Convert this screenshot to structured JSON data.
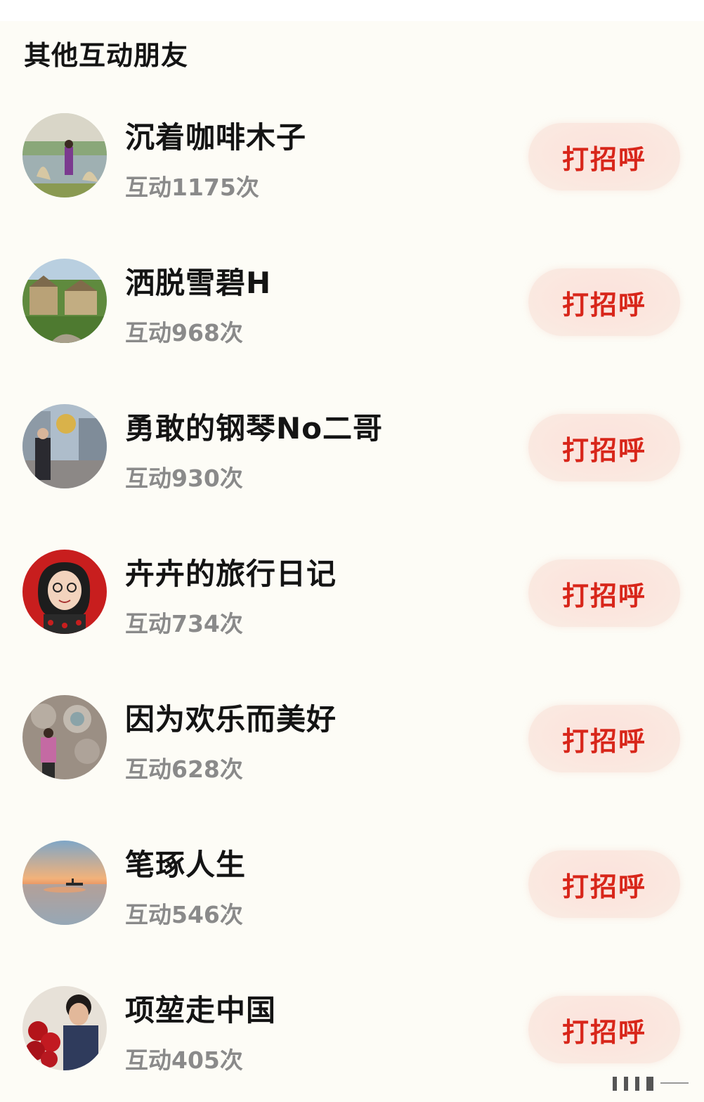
{
  "section": {
    "title": "其他互动朋友"
  },
  "friends": [
    {
      "name": "沉着咖啡木子",
      "count": "互动1175次",
      "button_label": "打招呼",
      "avatar_icon": "avatar-lakeside-photo"
    },
    {
      "name": "洒脱雪碧H",
      "count": "互动968次",
      "button_label": "打招呼",
      "avatar_icon": "avatar-village-photo"
    },
    {
      "name": "勇敢的钢琴No二哥",
      "count": "互动930次",
      "button_label": "打招呼",
      "avatar_icon": "avatar-city-square-photo"
    },
    {
      "name": "卉卉的旅行日记",
      "count": "互动734次",
      "button_label": "打招呼",
      "avatar_icon": "avatar-cartoon-portrait"
    },
    {
      "name": "因为欢乐而美好",
      "count": "互动628次",
      "button_label": "打招呼",
      "avatar_icon": "avatar-sculpture-wall-photo"
    },
    {
      "name": "笔琢人生",
      "count": "互动546次",
      "button_label": "打招呼",
      "avatar_icon": "avatar-sunset-boat-photo"
    },
    {
      "name": "项堃走中国",
      "count": "互动405次",
      "button_label": "打招呼",
      "avatar_icon": "avatar-flowers-portrait"
    }
  ],
  "colors": {
    "page_background": "#fdfcf6",
    "button_text": "#d8261a",
    "button_background": "#fbe4dd",
    "name_text": "#141414",
    "count_text": "#8a8a8a"
  }
}
